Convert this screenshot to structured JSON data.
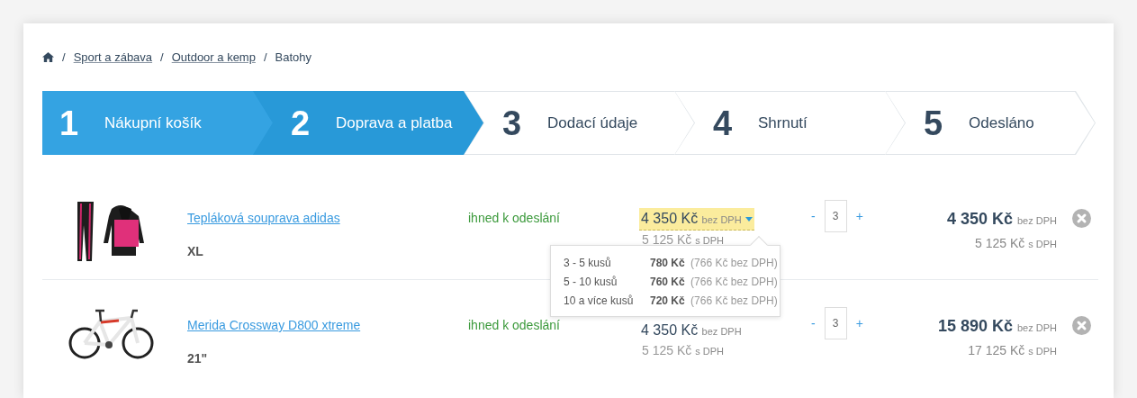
{
  "breadcrumb": [
    {
      "separator": "/",
      "label": "Sport a zábava",
      "link": true
    },
    {
      "separator": "/",
      "label": "Outdoor a kemp",
      "link": true
    },
    {
      "separator": "/",
      "label": "Batohy",
      "link": false
    }
  ],
  "steps": [
    {
      "number": "1",
      "label": "Nákupní košík",
      "completed": true,
      "selected": false
    },
    {
      "number": "2",
      "label": "Doprava a platba",
      "completed": false,
      "selected": true
    },
    {
      "number": "3",
      "label": "Dodací údaje",
      "completed": false,
      "selected": false
    },
    {
      "number": "4",
      "label": "Shrnutí",
      "completed": false,
      "selected": false
    },
    {
      "number": "5",
      "label": "Odesláno",
      "completed": false,
      "selected": false
    }
  ],
  "cart_items": [
    {
      "name": "Tepláková souprava adidas",
      "variant": "XL",
      "availability": "ihned k odeslání",
      "price": "4 350 Kč",
      "price_note": "bez DPH",
      "price_vat": "5 125 Kč",
      "price_vat_note": "s DPH",
      "price_highlighted": true,
      "qty_minus": "-",
      "quantity": "3",
      "qty_plus": "+",
      "total": "4 350 Kč",
      "total_note": "bez DPH",
      "total_vat": "5 125 Kč",
      "total_vat_note": "s DPH"
    },
    {
      "name": "Merida Crossway D800 xtreme",
      "variant": "21\"",
      "availability": "ihned k odeslání",
      "price": "4 350 Kč",
      "price_note": "bez DPH",
      "price_vat": "5 125 Kč",
      "price_vat_note": "s DPH",
      "price_highlighted": false,
      "qty_minus": "-",
      "quantity": "3",
      "qty_plus": "+",
      "total": "15 890 Kč",
      "total_note": "bez DPH",
      "total_vat": "17 125 Kč",
      "total_vat_note": "s DPH"
    }
  ],
  "price_popover": {
    "tiers": [
      {
        "quantity": "3 - 5 kusů",
        "price": "780 Kč",
        "note": "(766 Kč bez DPH)"
      },
      {
        "quantity": "5 - 10 kusů",
        "price": "760 Kč",
        "note": "(766 Kč bez DPH)"
      },
      {
        "quantity": "10 a více kusů",
        "price": "720 Kč",
        "note": "(766 Kč bez DPH)"
      }
    ]
  }
}
